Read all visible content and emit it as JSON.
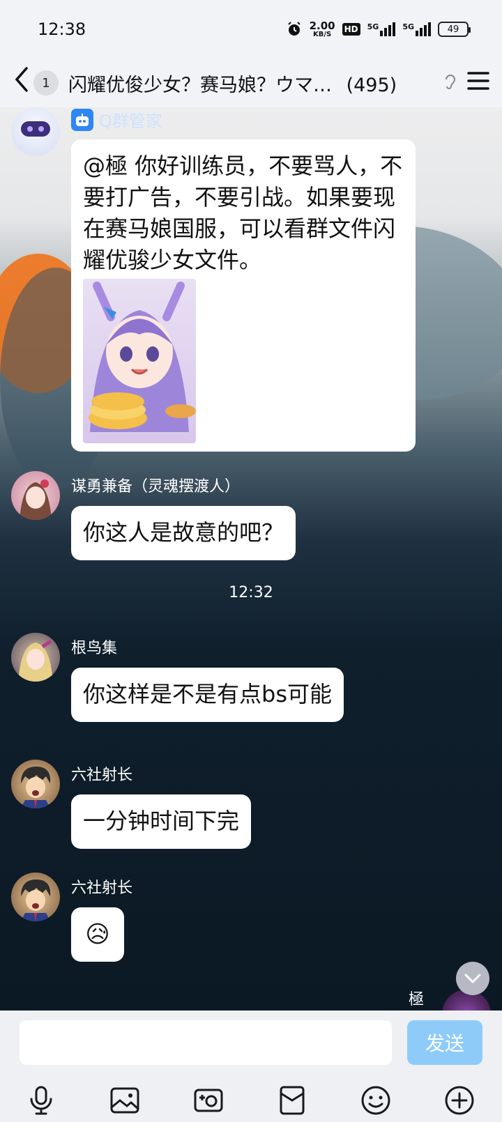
{
  "status_bar": {
    "time": "12:38",
    "net_speed": "2.00",
    "net_unit": "KB/S",
    "hd_label": "HD",
    "signal1_label": "5G",
    "signal2_label": "5G",
    "battery": "49"
  },
  "header": {
    "unread_count": "1",
    "title": "闪耀优俊少女？赛马娘？ウマ…",
    "member_count": "(495)"
  },
  "messages": [
    {
      "sender": "Q群管家",
      "text": "@極 你好训练员，不要骂人，不要打广告，不要引战。如果要现在赛马娘国服，可以看群文件闪耀优骏少女文件。"
    },
    {
      "sender": "谋勇兼备（灵魂摆渡人）",
      "text": "你这人是故意的吧？"
    },
    {
      "sender": "根鸟集",
      "text": "你这样是不是有点bs可能"
    },
    {
      "sender": "六社射长",
      "text": "一分钟时间下完"
    },
    {
      "sender": "六社射长",
      "text": "😥"
    },
    {
      "sender": "極",
      "text": ""
    }
  ],
  "timestamp": "12:32",
  "composer": {
    "send_label": "发送"
  },
  "colors": {
    "accent": "#2f86f6",
    "send_button": "#8ecbf9",
    "bar_bg": "#f2f3f7"
  }
}
